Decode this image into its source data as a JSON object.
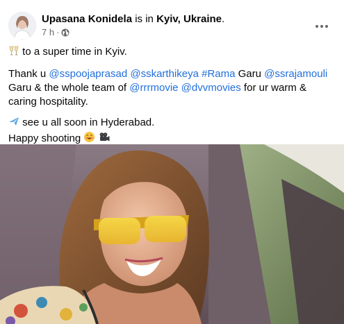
{
  "post": {
    "author": "Upasana Konidela",
    "connector": "is in",
    "location": "Kyiv, Ukraine",
    "period": ".",
    "time": "7 h",
    "separator": "·",
    "line1_text": " to a super time in Kyiv.",
    "p2": {
      "t1": "Thank u ",
      "m1": "@sspoojaprasad",
      "m2": "@sskarthikeya",
      "m3": "#Rama",
      "t2": " Garu ",
      "m4": "@ssrajamouli",
      "t3": "Garu & the whole team of ",
      "m5": "@rrrmovie",
      "m6": "@dvvmovies",
      "t4": " for ur warm & caring hospitality."
    },
    "p3": {
      "t1": " see u all soon in Hyderabad.",
      "t2": "Happy shooting "
    }
  },
  "icons": {
    "more": "more-horizontal-icon",
    "audience": "globe-icon",
    "toast": "clinking-glasses-icon",
    "plane": "airplane-icon",
    "smile": "smiling-face-icon",
    "camera": "movie-camera-icon"
  },
  "colors": {
    "link": "#216fdb",
    "meta": "#65676b",
    "text": "#050505"
  }
}
